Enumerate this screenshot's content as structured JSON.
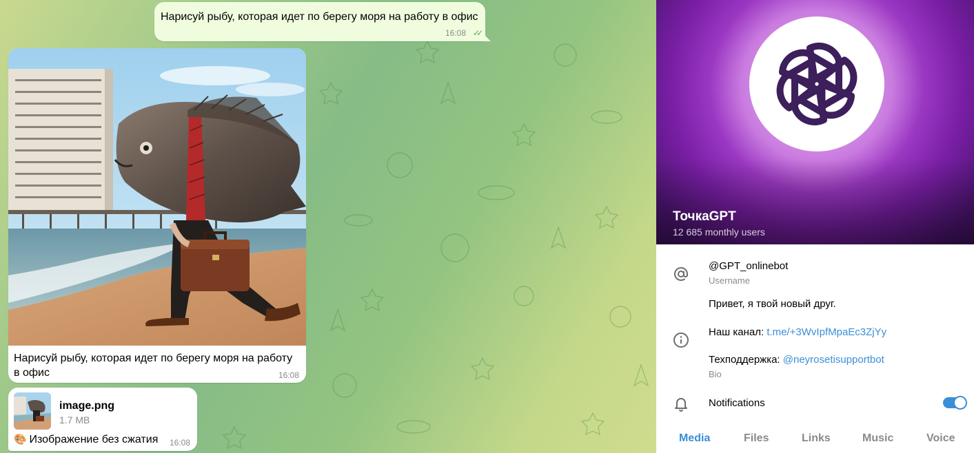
{
  "chat": {
    "messages": [
      {
        "text": "Нарисуй рыбу, которая идет по берегу моря на работу в офис",
        "time": "16:08"
      },
      {
        "text": "Нарисуй рыбу, которая идет по берегу моря на работу в офис",
        "time": "16:08"
      },
      {
        "file_name": "image.png",
        "file_size": "1.7 MB",
        "caption": "Изображение без сжатия",
        "caption_icon": "palette-icon",
        "time": "16:08"
      }
    ]
  },
  "profile": {
    "name": "ТочкаGPT",
    "subtitle": "12 685 monthly users",
    "username": "@GPT_onlinebot",
    "username_label": "Username",
    "bio_line1": "Привет, я твой новый друг.",
    "channel_prefix": "Наш канал: ",
    "channel_link": "t.me/+3WvIpfMpaEc3ZjYy",
    "support_prefix": "Техподдержка: ",
    "support_link": "@neyrosetisupportbot",
    "bio_label": "Bio",
    "notifications_label": "Notifications",
    "notifications_on": true,
    "tabs": [
      "Media",
      "Files",
      "Links",
      "Music",
      "Voice"
    ],
    "active_tab": "Media"
  },
  "colors": {
    "accent": "#3a8fd6",
    "outgoing_bubble": "#effdde",
    "hero_purple": "#9b38c3"
  },
  "icons": [
    "at-icon",
    "info-icon",
    "bell-icon",
    "double-check-icon",
    "openai-logo-icon"
  ]
}
